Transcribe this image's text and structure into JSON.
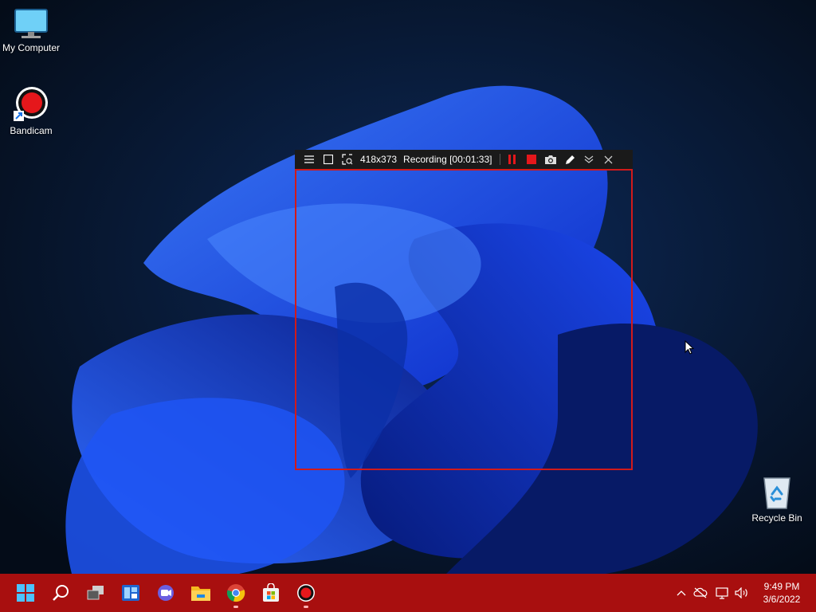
{
  "desktop": {
    "icons": [
      {
        "label": "My Computer"
      },
      {
        "label": "Bandicam"
      },
      {
        "label": "Recycle Bin"
      }
    ]
  },
  "bandicam": {
    "size": "418x373",
    "status": "Recording [00:01:33]",
    "accent": "#d11a1a"
  },
  "taskbar": {
    "color": "#a80f0f",
    "apps": [
      "start-icon",
      "search-icon",
      "task-view-icon",
      "widgets-icon",
      "chat-icon",
      "file-explorer-icon",
      "chrome-icon",
      "store-icon",
      "bandicam-icon"
    ],
    "clock": {
      "time": "9:49 PM",
      "date": "3/6/2022"
    }
  }
}
